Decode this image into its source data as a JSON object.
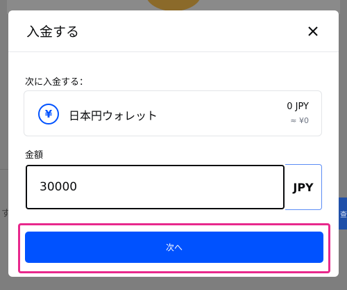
{
  "background": {
    "left_text": "す",
    "right_button_text": "查"
  },
  "modal": {
    "title": "入金する",
    "deposit_to_label": "次に入金する：",
    "wallet": {
      "icon_symbol": "¥",
      "name": "日本円ウォレット",
      "balance": "0 JPY",
      "approx_value": "≈ ¥0"
    },
    "amount_label": "金額",
    "amount_value": "30000",
    "currency": "JPY",
    "next_button": "次へ"
  },
  "colors": {
    "primary": "#0052ff",
    "highlight": "#e8288c",
    "overlay": "#7e7e7e"
  }
}
